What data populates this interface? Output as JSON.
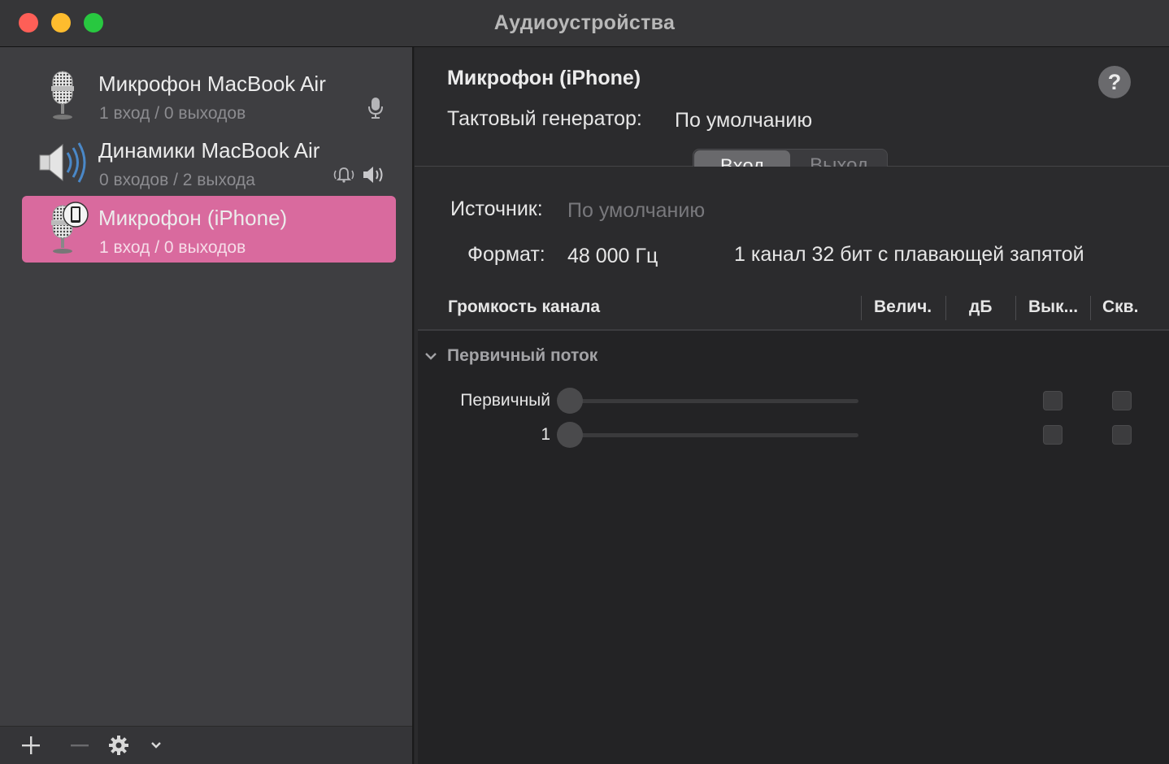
{
  "window": {
    "title": "Аудиоустройства"
  },
  "sidebar": {
    "devices": [
      {
        "name": "Микрофон MacBook Air",
        "subtitle": "1 вход / 0 выходов",
        "icon": "microphone-icon",
        "badges": [
          "microphone-badge-icon"
        ]
      },
      {
        "name": "Динамики MacBook Air",
        "subtitle": "0 входов / 2 выхода",
        "icon": "speaker-icon",
        "badges": [
          "alert-sound-icon",
          "speaker-output-icon"
        ]
      },
      {
        "name": "Микрофон (iPhone)",
        "subtitle": "1 вход / 0 выходов",
        "icon": "iphone-microphone-icon",
        "badges": [],
        "selected": true
      }
    ],
    "toolbar": {
      "add": "+",
      "remove": "−"
    }
  },
  "detail": {
    "title": "Микрофон (iPhone)",
    "help": "?",
    "clock_label": "Тактовый генератор:",
    "clock_value": "По умолчанию",
    "tabs": [
      {
        "label": "Вход",
        "active": true
      },
      {
        "label": "Выход",
        "active": false
      }
    ],
    "source_label": "Источник:",
    "source_value": "По умолчанию",
    "format_label": "Формат:",
    "format_rate": "48 000 Гц",
    "format_desc": "1 канал 32 бит с плавающей запятой",
    "table": {
      "headers": [
        "Громкость канала",
        "Велич.",
        "дБ",
        "Вык...",
        "Скв."
      ],
      "group": "Первичный поток",
      "rows": [
        {
          "label": "Первичный",
          "level": 0,
          "mute": false,
          "thru": false
        },
        {
          "label": "1",
          "level": 0,
          "mute": false,
          "thru": false
        }
      ]
    }
  },
  "colors": {
    "accent_selection": "#d96a9e",
    "close": "#fe5f57",
    "minimize": "#febc2e",
    "maximize": "#28c840"
  }
}
